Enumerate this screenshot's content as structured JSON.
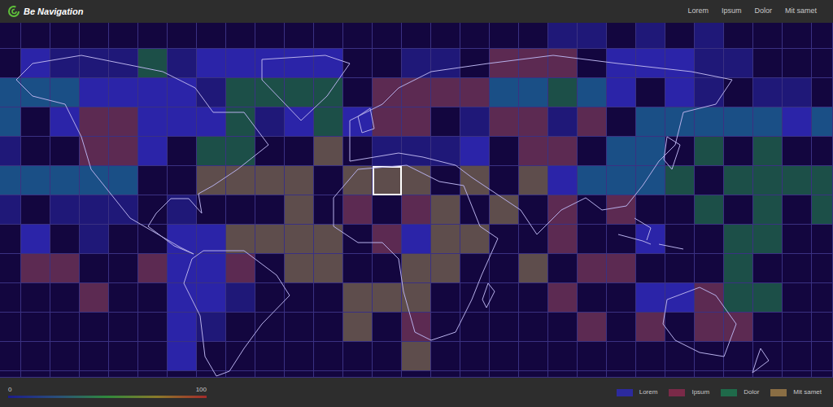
{
  "header": {
    "title": "Be Navigation",
    "nav": [
      {
        "label": "Lorem"
      },
      {
        "label": "Ipsum"
      },
      {
        "label": "Dolor"
      },
      {
        "label": "Mit samet"
      }
    ]
  },
  "grid": {
    "palette": [
      "#13063f",
      "#2b24a8",
      "#5c2a52",
      "#1c4f48",
      "#5e4d4c",
      "#1a4f86",
      "#1f1878"
    ],
    "selected": [
      5,
      13
    ],
    "rows": [
      [
        0,
        0,
        0,
        0,
        0,
        0,
        0,
        0,
        0,
        0,
        0,
        0,
        0,
        0,
        0,
        0,
        0,
        0,
        0,
        6,
        6,
        0,
        6,
        0,
        6,
        0,
        0,
        0,
        0
      ],
      [
        0,
        1,
        6,
        6,
        6,
        3,
        6,
        1,
        1,
        1,
        1,
        1,
        0,
        0,
        6,
        6,
        0,
        2,
        2,
        2,
        0,
        1,
        1,
        1,
        6,
        6,
        0,
        0,
        0
      ],
      [
        5,
        5,
        5,
        1,
        1,
        1,
        1,
        6,
        3,
        3,
        3,
        3,
        0,
        2,
        2,
        2,
        2,
        5,
        5,
        3,
        5,
        1,
        0,
        1,
        6,
        0,
        6,
        6,
        0
      ],
      [
        5,
        0,
        1,
        2,
        2,
        1,
        1,
        1,
        3,
        6,
        1,
        3,
        1,
        2,
        2,
        0,
        6,
        2,
        2,
        6,
        2,
        0,
        5,
        5,
        5,
        5,
        5,
        1,
        5
      ],
      [
        6,
        0,
        0,
        2,
        2,
        1,
        0,
        3,
        3,
        0,
        0,
        4,
        0,
        6,
        6,
        6,
        1,
        0,
        2,
        2,
        0,
        5,
        5,
        0,
        3,
        0,
        3,
        0,
        0
      ],
      [
        5,
        5,
        5,
        5,
        5,
        0,
        0,
        4,
        4,
        4,
        4,
        0,
        4,
        4,
        4,
        0,
        4,
        0,
        4,
        1,
        5,
        5,
        5,
        3,
        0,
        3,
        3,
        3,
        3
      ],
      [
        6,
        0,
        6,
        6,
        6,
        0,
        6,
        0,
        0,
        0,
        4,
        0,
        2,
        0,
        2,
        4,
        0,
        4,
        0,
        2,
        0,
        2,
        0,
        0,
        3,
        0,
        3,
        0,
        3
      ],
      [
        0,
        1,
        0,
        6,
        0,
        0,
        1,
        1,
        4,
        4,
        4,
        4,
        0,
        2,
        1,
        4,
        4,
        0,
        0,
        2,
        0,
        0,
        1,
        0,
        0,
        3,
        3,
        0,
        0
      ],
      [
        0,
        2,
        2,
        0,
        0,
        2,
        1,
        1,
        2,
        0,
        4,
        4,
        0,
        0,
        4,
        4,
        0,
        0,
        4,
        0,
        2,
        2,
        0,
        0,
        0,
        3,
        0,
        0,
        0
      ],
      [
        0,
        0,
        0,
        2,
        0,
        0,
        1,
        1,
        6,
        0,
        0,
        0,
        4,
        4,
        4,
        0,
        0,
        0,
        0,
        2,
        0,
        0,
        1,
        1,
        2,
        3,
        3,
        0,
        0
      ],
      [
        0,
        0,
        0,
        0,
        0,
        0,
        1,
        6,
        0,
        0,
        0,
        0,
        4,
        0,
        2,
        0,
        0,
        0,
        0,
        0,
        2,
        0,
        2,
        0,
        2,
        2,
        0,
        0,
        0
      ],
      [
        0,
        0,
        0,
        0,
        0,
        0,
        1,
        0,
        0,
        0,
        0,
        0,
        0,
        0,
        4,
        0,
        0,
        0,
        0,
        0,
        0,
        0,
        0,
        0,
        0,
        0,
        0,
        0,
        0
      ],
      [
        0,
        0,
        0,
        0,
        0,
        0,
        0,
        0,
        0,
        0,
        0,
        0,
        0,
        0,
        0,
        0,
        0,
        0,
        0,
        0,
        0,
        0,
        0,
        0,
        0,
        0,
        0,
        0,
        0
      ]
    ]
  },
  "scale": {
    "min": "0",
    "max": "100",
    "colors": [
      "#1c1c8c",
      "#2a4f7a",
      "#2f8a3c",
      "#8a7a2a",
      "#a42a2a"
    ]
  },
  "legend": [
    {
      "label": "Lorem",
      "color": "#2c2a9e"
    },
    {
      "label": "Ipsum",
      "color": "#7a2a48"
    },
    {
      "label": "Dolor",
      "color": "#1f6a4a"
    },
    {
      "label": "Mit samet",
      "color": "#8a6e44"
    }
  ]
}
